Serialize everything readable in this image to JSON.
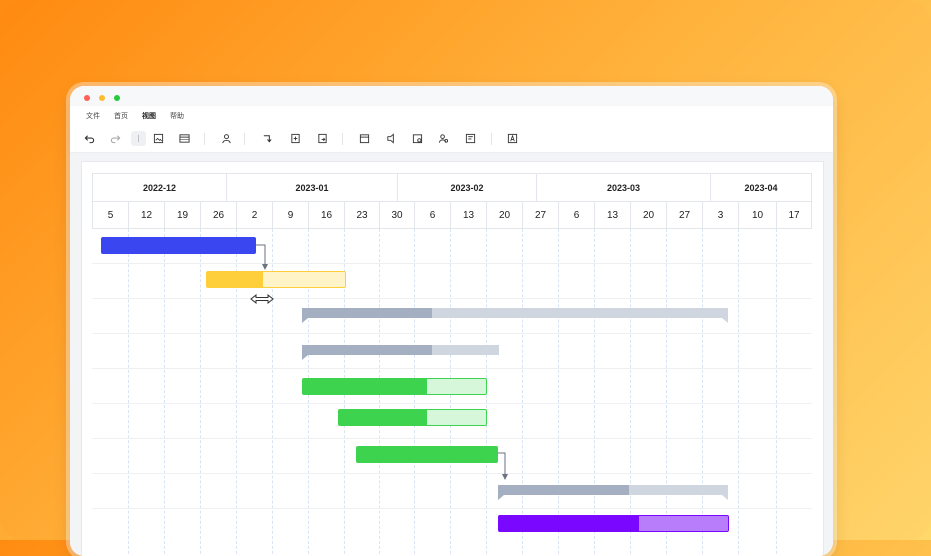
{
  "menu": {
    "items": [
      "文件",
      "首页",
      "视图",
      "帮助"
    ],
    "active_index": 2
  },
  "toolbar": {
    "buttons": [
      "undo-icon",
      "redo-icon",
      "cursor-icon",
      "image-icon",
      "table-icon",
      "user-settings-icon",
      "link-down-icon",
      "add-subtask-icon",
      "export-icon",
      "calendar-icon",
      "milestone-icon",
      "resource-icon",
      "assign-icon",
      "report-icon",
      "text-icon"
    ]
  },
  "gantt": {
    "months": [
      "2022-12",
      "2023-01",
      "2023-02",
      "2023-03",
      "2023-04"
    ],
    "days": [
      "5",
      "12",
      "19",
      "26",
      "2",
      "9",
      "16",
      "23",
      "30",
      "6",
      "13",
      "20",
      "27",
      "6",
      "13",
      "20",
      "27",
      "3",
      "10",
      "17"
    ]
  },
  "colors": {
    "blue": "#3a47f0",
    "yellow": "#ffcf3b",
    "yellow_light": "#fff3c8",
    "summary_done": "#a4b0c2",
    "summary_rest": "#cfd6e0",
    "green": "#3dd34f",
    "green_light": "#d6f7da",
    "purple": "#7a07ff",
    "purple_light": "#b77dfb"
  }
}
